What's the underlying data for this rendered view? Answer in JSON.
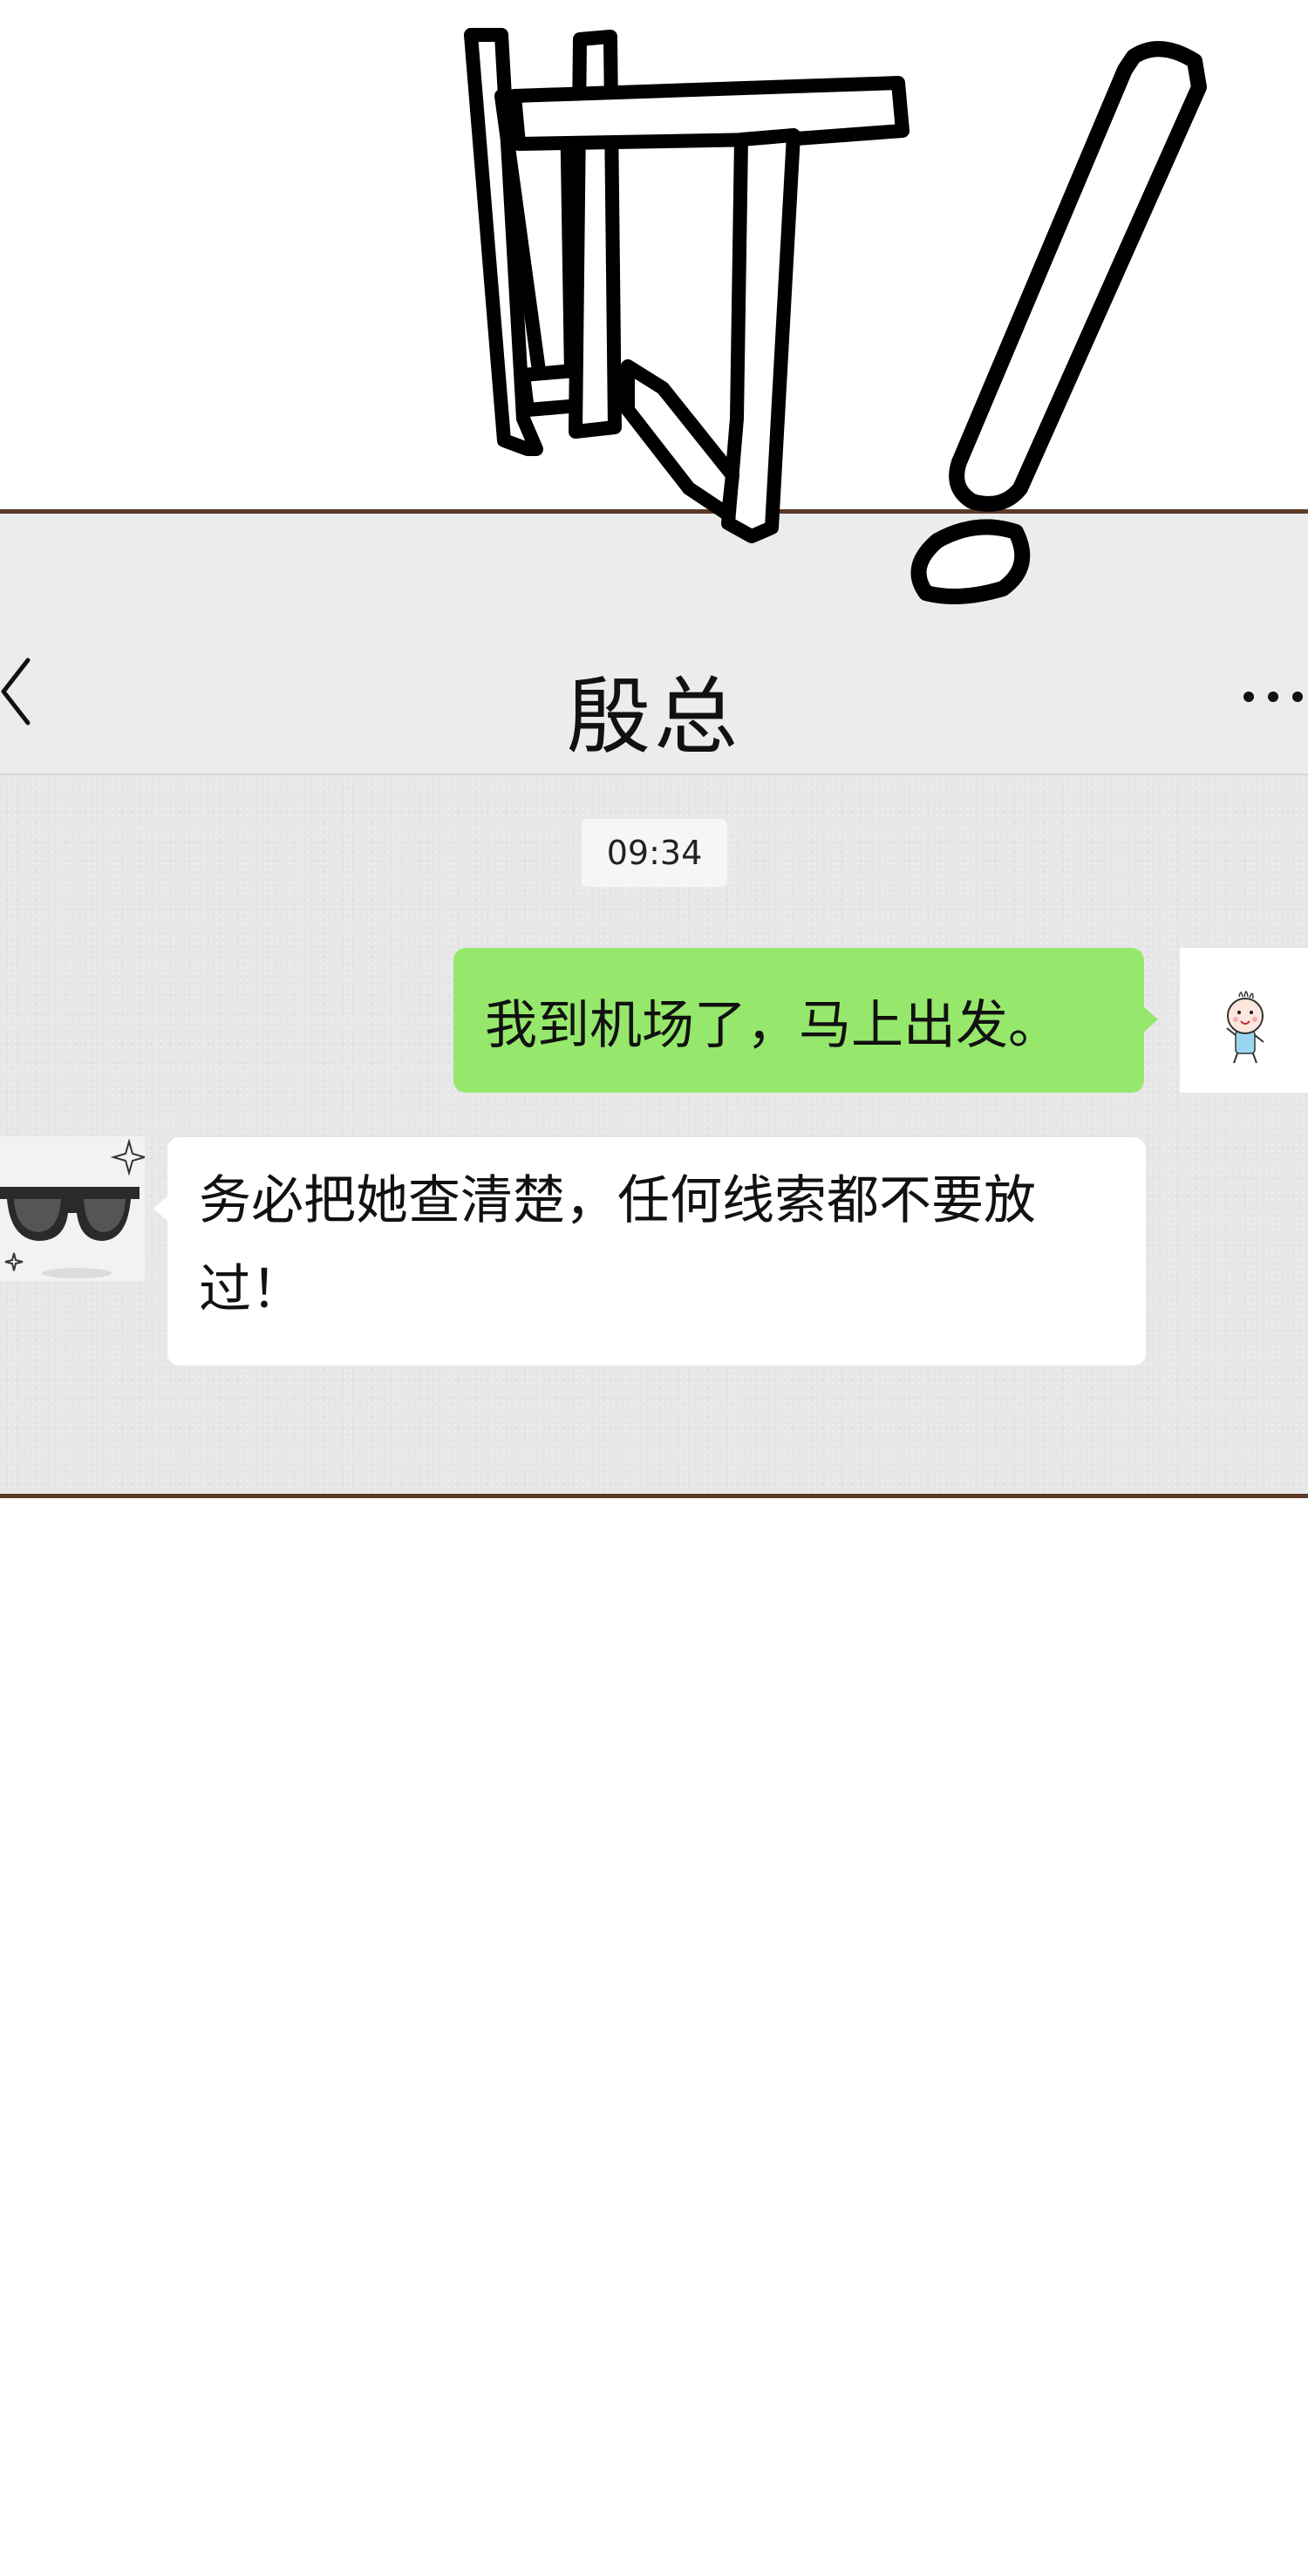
{
  "sound_effect": {
    "text": "叮！"
  },
  "header": {
    "title": "殷总",
    "back_icon": "chevron-left-icon",
    "more_icon": "more-dots-icon"
  },
  "chat": {
    "timestamp": "09:34",
    "messages": [
      {
        "side": "outgoing",
        "text": "我到机场了，马上出发。",
        "avatar": "cartoon-kid-avatar",
        "bubble_color": "#96e86c"
      },
      {
        "side": "incoming",
        "text": "务必把她查清楚，任何线索都不要放过！",
        "avatar": "sunglasses-avatar",
        "bubble_color": "#ffffff"
      }
    ]
  },
  "colors": {
    "frame_border": "#5b3a26",
    "nav_background": "#ececec",
    "chat_background": "#e7e7e7"
  }
}
